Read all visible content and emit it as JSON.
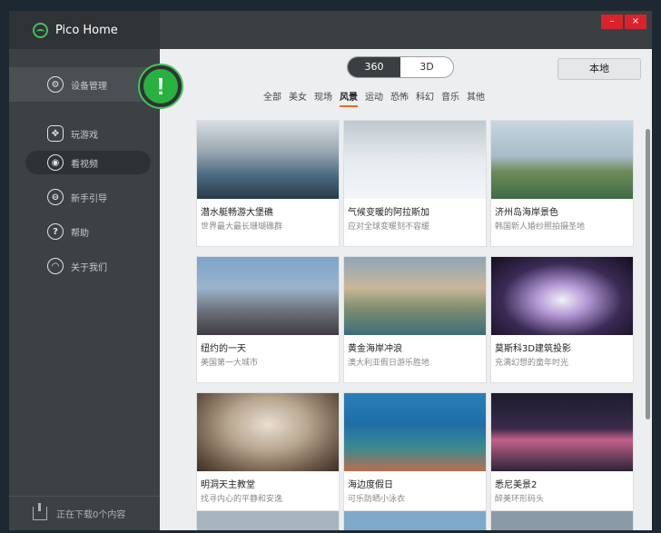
{
  "app": {
    "title": "Pico Home"
  },
  "sidebar": {
    "items": [
      {
        "label": "设备管理",
        "icon": "wrench-icon"
      },
      {
        "label": "玩游戏",
        "icon": "gamepad-icon"
      },
      {
        "label": "看视频",
        "icon": "video-icon"
      },
      {
        "label": "新手引导",
        "icon": "guide-icon"
      },
      {
        "label": "帮助",
        "icon": "help-icon"
      },
      {
        "label": "关于我们",
        "icon": "about-icon"
      }
    ],
    "downloading": "正在下载0个内容",
    "alert_symbol": "!"
  },
  "window_controls": {
    "minimize": "–",
    "close": "×"
  },
  "mode_toggle": {
    "options": [
      "360",
      "3D"
    ],
    "selected": "360"
  },
  "local_button": "本地",
  "categories": {
    "items": [
      "全部",
      "美女",
      "现场",
      "风景",
      "运动",
      "恐怖",
      "科幻",
      "音乐",
      "其他"
    ],
    "selected": "风景"
  },
  "videos": [
    {
      "title": "潜水艇畅游大堡礁",
      "subtitle": "世界最大最长珊瑚礁群"
    },
    {
      "title": "气候变暖的阿拉斯加",
      "subtitle": "应对全球变暖刻不容缓"
    },
    {
      "title": "济州岛海岸景色",
      "subtitle": "韩国新人婚纱照拍摄圣地"
    },
    {
      "title": "纽约的一天",
      "subtitle": "美国第一大城市"
    },
    {
      "title": "黄金海岸冲浪",
      "subtitle": "澳大利亚假日游乐胜地"
    },
    {
      "title": "莫斯科3D建筑投影",
      "subtitle": "充满幻想的童年时光"
    },
    {
      "title": "明洞天主教堂",
      "subtitle": "找寻内心的平静和安逸"
    },
    {
      "title": "海边度假日",
      "subtitle": "可乐防晒小泳衣"
    },
    {
      "title": "悉尼美景2",
      "subtitle": "醉美环形码头"
    }
  ],
  "colors": {
    "accent": "#ef6a1f",
    "brand": "#3fc05c",
    "sidebar": "#3c4144"
  }
}
